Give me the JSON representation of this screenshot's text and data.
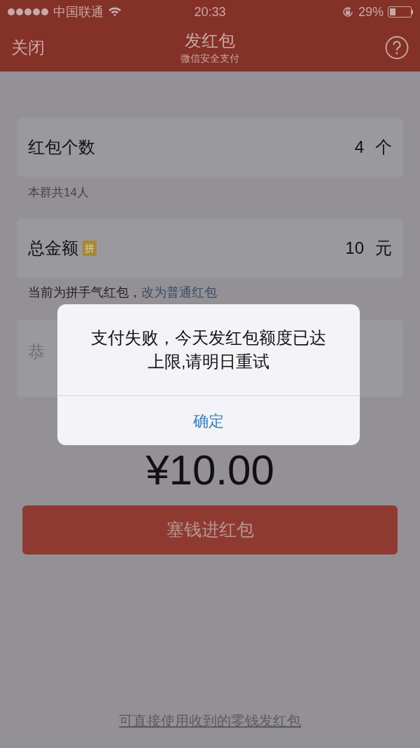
{
  "status_bar": {
    "carrier": "中国联通",
    "time": "20:33",
    "battery": "29%"
  },
  "nav": {
    "left": "关闭",
    "title": "发红包",
    "subtitle": "微信安全支付"
  },
  "count_row": {
    "label": "红包个数",
    "value": "4",
    "unit": "个"
  },
  "count_note": "本群共14人",
  "amount_row": {
    "label": "总金额",
    "badge": "拼",
    "value": "10",
    "unit": "元"
  },
  "amount_note": {
    "text": "当前为拼手气红包，",
    "link": "改为普通红包"
  },
  "message_field": {
    "placeholder": "恭"
  },
  "total": "¥10.00",
  "submit_button": "塞钱进红包",
  "footer_link": "可直接使用收到的零钱发红包",
  "alert": {
    "message": "支付失败，今天发红包额度已达上限,请明日重试",
    "button": "确定"
  }
}
